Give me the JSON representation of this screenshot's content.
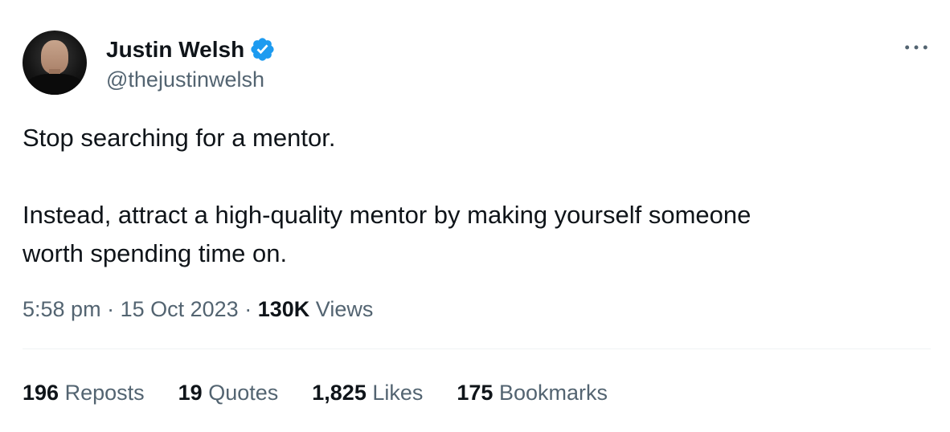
{
  "author": {
    "display_name": "Justin Welsh",
    "handle": "@thejustinwelsh",
    "verified": true,
    "avatar_icon": "profile-photo"
  },
  "tweet": {
    "lines": [
      "Stop searching for a mentor.",
      "Instead, attract a high-quality mentor by making yourself someone",
      "worth spending time on."
    ]
  },
  "meta": {
    "time": "5:58 pm",
    "separator": "·",
    "date": "15 Oct 2023",
    "views_count": "130K",
    "views_label": "Views"
  },
  "stats": {
    "reposts": {
      "count": "196",
      "label": "Reposts"
    },
    "quotes": {
      "count": "19",
      "label": "Quotes"
    },
    "likes": {
      "count": "1,825",
      "label": "Likes"
    },
    "bookmarks": {
      "count": "175",
      "label": "Bookmarks"
    }
  },
  "icons": {
    "verified": "verified-badge-icon",
    "more": "more-options-icon"
  },
  "colors": {
    "text_primary": "#0f1419",
    "text_secondary": "#536471",
    "verified_blue": "#1d9bf0",
    "divider": "#eff3f4"
  }
}
